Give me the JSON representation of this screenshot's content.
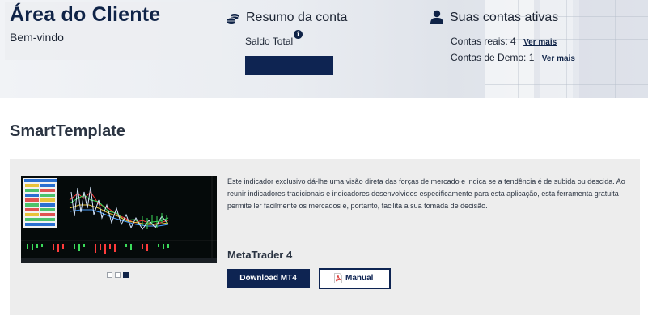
{
  "header": {
    "title": "Área do Cliente",
    "welcome": "Bem-vindo"
  },
  "summary": {
    "title": "Resumo da conta",
    "balance_label": "Saldo Total",
    "icon": "coins-icon",
    "info_icon": "info-icon"
  },
  "accounts": {
    "title": "Suas contas ativas",
    "icon": "user-icon",
    "real": {
      "label": "Contas reais: 4",
      "link": "Ver mais"
    },
    "demo": {
      "label": "Contas de Demo: 1",
      "link": "Ver mais"
    }
  },
  "product": {
    "title": "SmartTemplate",
    "description": "Este indicador exclusivo dá-lhe uma visão direta das forças de mercado e indica se a tendência é de subida ou descida. Ao reunir indicadores tradicionais e indicadores desenvolvidos especificamente para esta aplicação, esta ferramenta gratuita permite ler facilmente os mercados e, portanto, facilita a sua tomada de decisão.",
    "platform": "MetaTrader 4",
    "download_label": "Download MT4",
    "manual_label": "Manual",
    "carousel": {
      "slides": 3,
      "active": 3
    }
  },
  "colors": {
    "brand_navy": "#0e2452",
    "title_navy": "#0f2347",
    "card_bg": "#ededed"
  }
}
